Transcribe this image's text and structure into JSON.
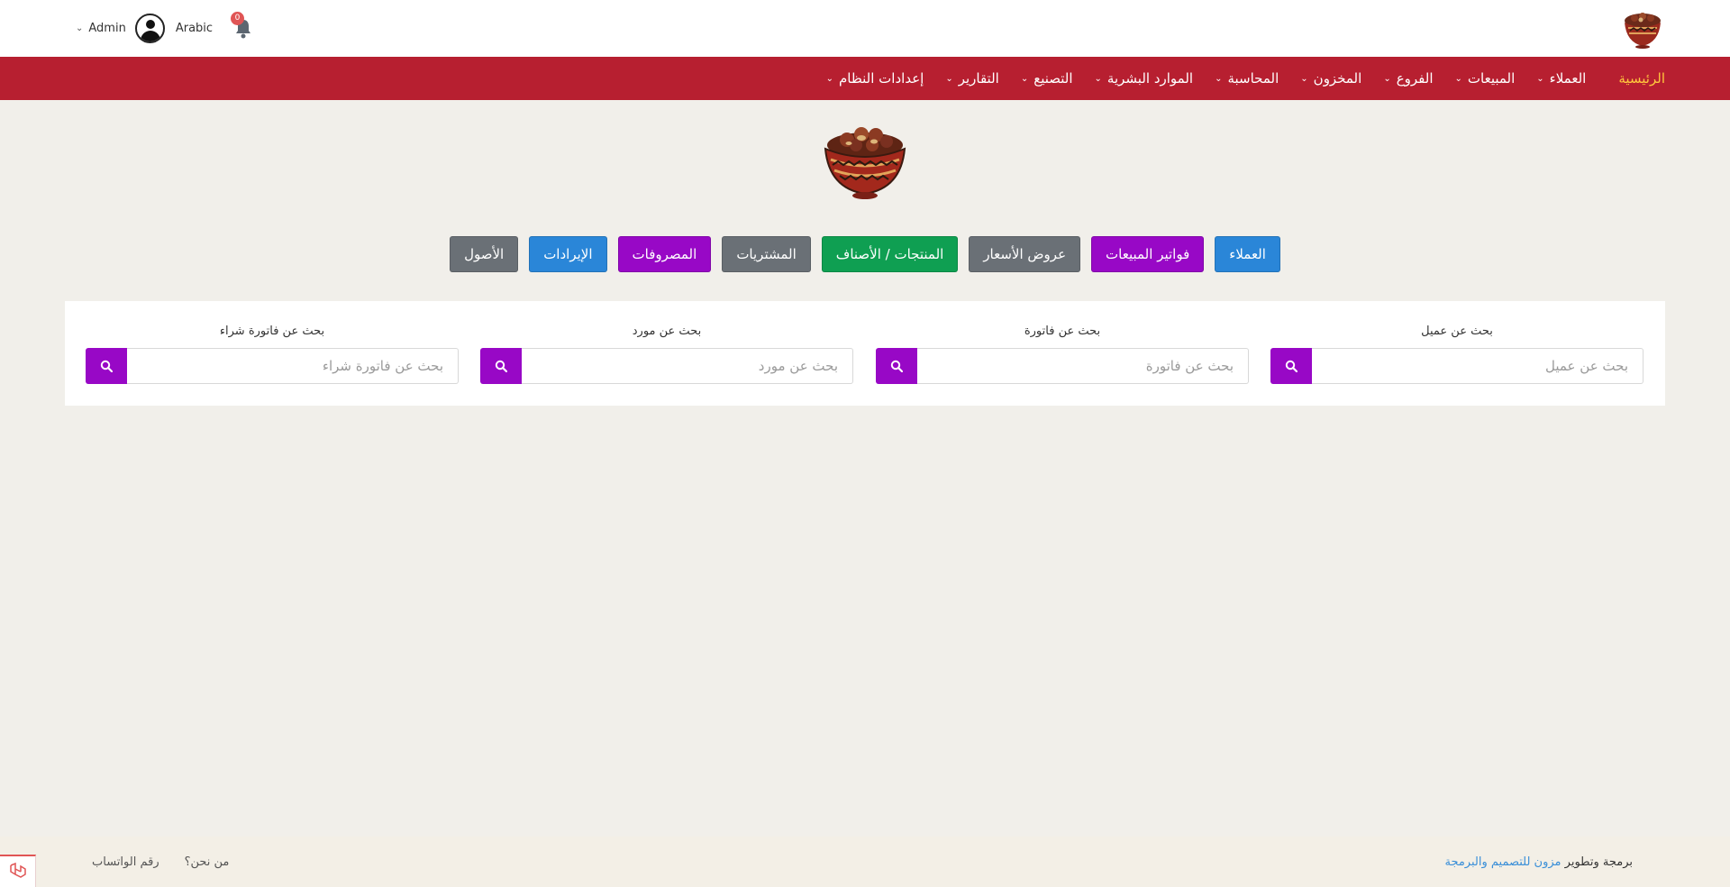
{
  "topbar": {
    "admin_label": "Admin",
    "language": "Arabic",
    "notification_count": "0"
  },
  "nav": {
    "items": [
      {
        "label": "الرئيسية",
        "active": true,
        "has_dropdown": false
      },
      {
        "label": "العملاء",
        "active": false,
        "has_dropdown": true
      },
      {
        "label": "المبيعات",
        "active": false,
        "has_dropdown": true
      },
      {
        "label": "الفروع",
        "active": false,
        "has_dropdown": true
      },
      {
        "label": "المخزون",
        "active": false,
        "has_dropdown": true
      },
      {
        "label": "المحاسبة",
        "active": false,
        "has_dropdown": true
      },
      {
        "label": "الموارد البشرية",
        "active": false,
        "has_dropdown": true
      },
      {
        "label": "التصنيع",
        "active": false,
        "has_dropdown": true
      },
      {
        "label": "التقارير",
        "active": false,
        "has_dropdown": true
      },
      {
        "label": "إعدادات النظام",
        "active": false,
        "has_dropdown": true
      }
    ]
  },
  "quick_buttons": [
    {
      "label": "العملاء",
      "color": "blue"
    },
    {
      "label": "فواتير المبيعات",
      "color": "purple"
    },
    {
      "label": "عروض الأسعار",
      "color": "gray"
    },
    {
      "label": "المنتجات / الأصناف",
      "color": "green"
    },
    {
      "label": "المشتريات",
      "color": "gray"
    },
    {
      "label": "المصروفات",
      "color": "purple"
    },
    {
      "label": "الإيرادات",
      "color": "blue"
    },
    {
      "label": "الأصول",
      "color": "gray"
    }
  ],
  "search": {
    "customer": {
      "label": "بحث عن عميل",
      "placeholder": "بحث عن عميل"
    },
    "invoice": {
      "label": "بحث عن فاتورة",
      "placeholder": "بحث عن فاتورة"
    },
    "supplier": {
      "label": "بحث عن مورد",
      "placeholder": "بحث عن مورد"
    },
    "purchase_invoice": {
      "label": "بحث عن فاتورة شراء",
      "placeholder": "بحث عن فاتورة شراء"
    }
  },
  "footer": {
    "credit_prefix": "برمجة وتطوير",
    "credit_link": "مزون للتصميم والبرمجة",
    "about": "من نحن؟",
    "whatsapp": "رقم الواتساب"
  },
  "colors": {
    "nav_bg": "#b71f30",
    "nav_active": "#ffc83d",
    "blue": "#2a86d8",
    "purple": "#9808c6",
    "gray": "#6a7076",
    "green": "#0f9f52",
    "page_bg": "#f1efea"
  },
  "icons": {
    "bell": "bell-icon",
    "avatar": "user-avatar-icon",
    "search": "search-icon",
    "logo": "date-bowl-logo"
  }
}
